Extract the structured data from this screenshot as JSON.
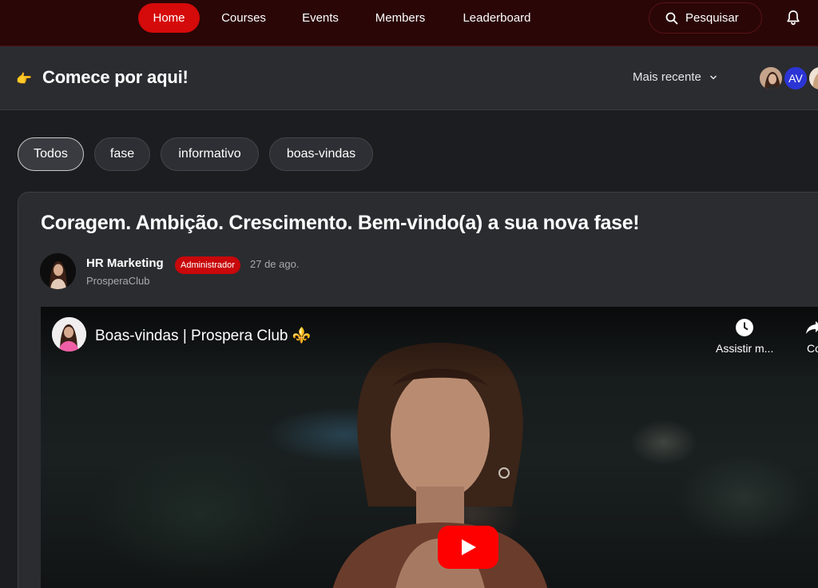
{
  "nav": {
    "items": [
      {
        "label": "Home",
        "active": true
      },
      {
        "label": "Courses",
        "active": false
      },
      {
        "label": "Events",
        "active": false
      },
      {
        "label": "Members",
        "active": false
      },
      {
        "label": "Leaderboard",
        "active": false
      }
    ],
    "search_label": "Pesquisar",
    "icons": {
      "search": "search-icon",
      "bell": "bell-icon"
    }
  },
  "header": {
    "icon": "pointing-hand-icon",
    "title": "Comece por aqui!",
    "sort_label": "Mais recente",
    "avatars": [
      {
        "type": "photo"
      },
      {
        "type": "initials",
        "text": "AV"
      },
      {
        "type": "photo"
      }
    ]
  },
  "filters": [
    {
      "label": "Todos",
      "active": true
    },
    {
      "label": "fase",
      "active": false
    },
    {
      "label": "informativo",
      "active": false
    },
    {
      "label": "boas-vindas",
      "active": false
    }
  ],
  "post": {
    "title": "Coragem. Ambição. Crescimento. Bem-vindo(a) a sua nova fase!",
    "author": {
      "name": "HR Marketing",
      "role": "Administrador",
      "date": "27 de ago.",
      "community": "ProsperaClub"
    },
    "video": {
      "title": "Boas-vindas | Prospera Club ⚜️",
      "actions": [
        {
          "label": "Assistir m...",
          "icon": "clock-icon"
        },
        {
          "label": "Co",
          "icon": "share-icon"
        }
      ]
    }
  },
  "colors": {
    "nav_bg": "#2a0607",
    "accent_red": "#d50a0a",
    "page_bg": "#1c1d21",
    "panel_bg": "#2b2c30",
    "youtube_red": "#ff0000"
  }
}
